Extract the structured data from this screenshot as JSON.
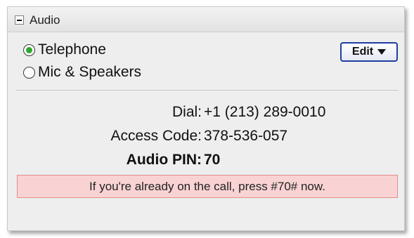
{
  "header": {
    "title": "Audio",
    "collapse_icon": "minus-icon"
  },
  "audio_options": {
    "telephone": {
      "label": "Telephone",
      "selected": true
    },
    "mic_speakers": {
      "label": "Mic & Speakers",
      "selected": false
    }
  },
  "edit_button": {
    "label": "Edit",
    "icon": "caret-down-icon",
    "border_color": "#1f3ea0"
  },
  "dial_info": {
    "dial_label": "Dial:",
    "dial_value": "+1 (213) 289-0010",
    "access_label": "Access Code:",
    "access_value": "378-536-057",
    "pin_label": "Audio PIN:",
    "pin_value": "70"
  },
  "notice": {
    "text": "If you're already on the call, press #70# now.",
    "background": "#f9d3d3",
    "border": "#e58c8c"
  },
  "colors": {
    "radio_selected": "#2ea82e"
  }
}
